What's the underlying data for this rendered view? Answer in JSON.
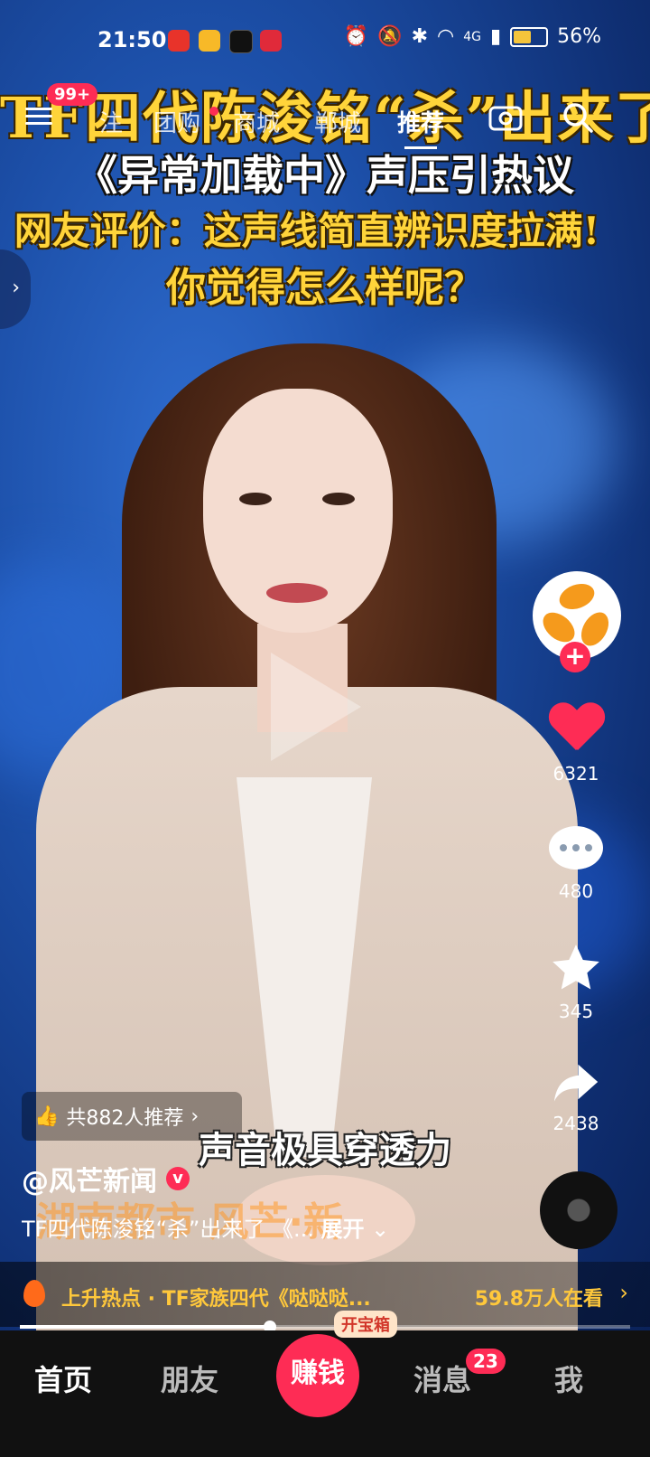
{
  "status_bar": {
    "time": "21:50",
    "battery_percent": "56%",
    "battery_level": 0.56,
    "network": "4G"
  },
  "top_nav": {
    "badge": "99+",
    "tabs": [
      {
        "label": "注"
      },
      {
        "label": "团购"
      },
      {
        "label": "商城"
      },
      {
        "label": "郸城"
      },
      {
        "label": "推荐"
      }
    ]
  },
  "headline": {
    "line1": "TF四代陈浚铭“杀”出来了",
    "line2": "《异常加载中》声压引热议",
    "line3": "网友评价：这声线简直辨识度拉满!",
    "line4": "你觉得怎么样呢？"
  },
  "actions": {
    "likes": "6321",
    "comments": "480",
    "favorites": "345",
    "shares": "2438"
  },
  "recommend_label": "共882人推荐",
  "subtitle": "声音极具穿透力",
  "author": "@风芒新闻",
  "description": "TF四代陈浚铭“杀”出来了 《...",
  "expand_label": "展开",
  "watermark": "湖南都市  风芒·新",
  "hotbar": {
    "text": "上升热点 · TF家族四代《哒哒哒...",
    "count": "59.8万人在看"
  },
  "progress_fraction": 0.41,
  "tabbar": {
    "home": "首页",
    "friends": "朋友",
    "earn": "赚钱",
    "treasure": "开宝箱",
    "messages": "消息",
    "messages_badge": "23",
    "me": "我"
  },
  "colors": {
    "accent": "#fe2c55",
    "headline": "#ffd43a",
    "hot": "#ffc83b"
  }
}
